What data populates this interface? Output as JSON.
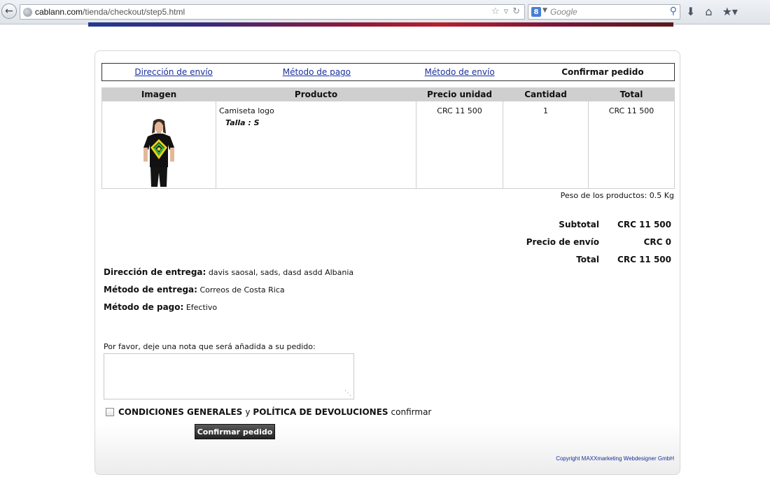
{
  "browser": {
    "url_domain": "cablann.com",
    "url_path": "/tienda/checkout/step5.html",
    "search_placeholder": "Google",
    "search_engine_badge": "8"
  },
  "steps": [
    {
      "label": "Dirección de envío",
      "link": true
    },
    {
      "label": "Método de pago",
      "link": true
    },
    {
      "label": "Método de envío",
      "link": true
    },
    {
      "label": "Confirmar pedido",
      "link": false
    }
  ],
  "cart": {
    "headers": [
      "Imagen",
      "Producto",
      "Precio unidad",
      "Cantidad",
      "Total"
    ],
    "rows": [
      {
        "product": "Camiseta logo",
        "attribute": "Talla : S",
        "unit_price": "CRC 11 500",
        "quantity": "1",
        "total": "CRC 11 500"
      }
    ]
  },
  "weight": "Peso de los productos: 0.5 Kg",
  "totals": [
    {
      "label": "Subtotal",
      "value": "CRC 11 500"
    },
    {
      "label": "Precio de envío",
      "value": "CRC 0"
    },
    {
      "label": "Total",
      "value": "CRC 11 500"
    }
  ],
  "delivery": {
    "address_label": "Dirección de entrega:",
    "address_value": "davis saosal, sads, dasd asdd Albania",
    "method_label": "Método de entrega:",
    "method_value": "Correos de Costa Rica",
    "payment_label": "Método de pago:",
    "payment_value": "Efectivo"
  },
  "note": {
    "label": "Por favor, deje una nota que será añadida a su pedido:",
    "value": ""
  },
  "terms": {
    "conditions": "CONDICIONES GENERALES",
    "and": "y",
    "policy": "POLÍTICA DE DEVOLUCIONES",
    "confirm": "confirmar"
  },
  "confirm_button": "Confirmar pedido",
  "copyright": "Copyright MAXXmarketing Webdesigner GmbH"
}
